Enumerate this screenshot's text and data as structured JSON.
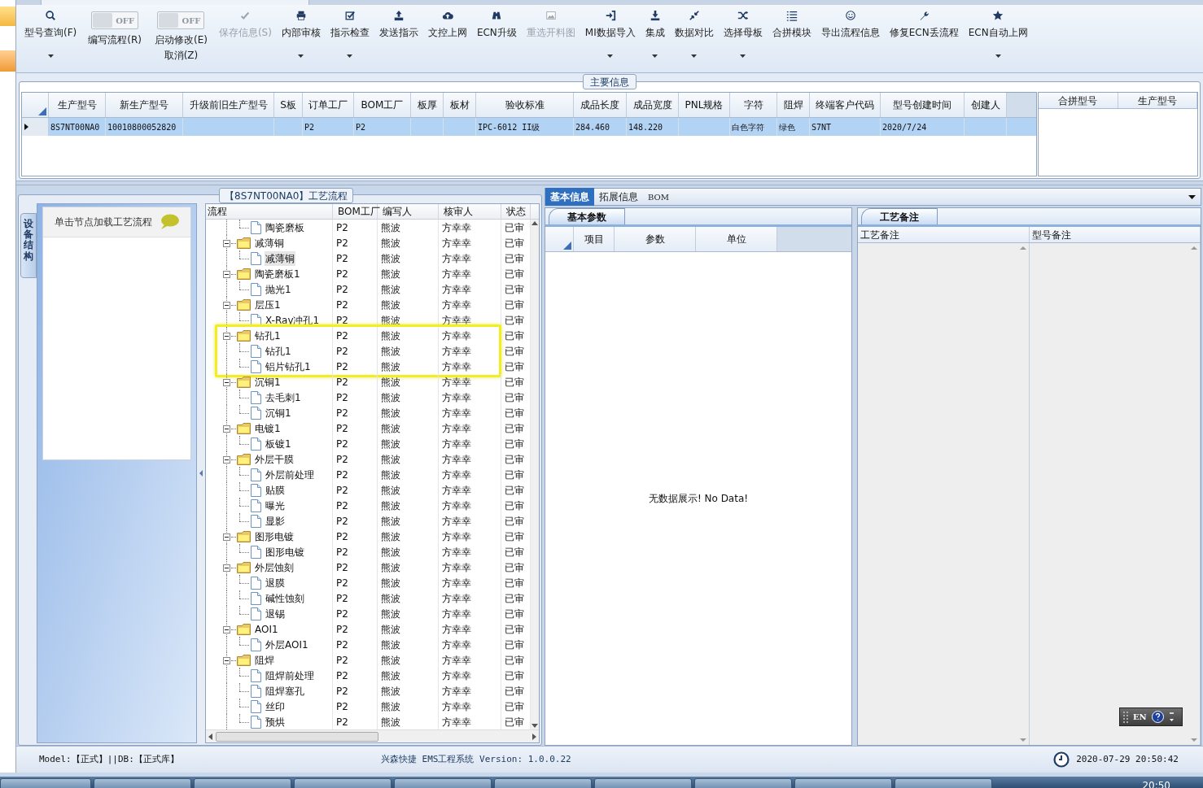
{
  "ribbon": {
    "items": [
      {
        "kind": "button",
        "label": "型号查询(F)",
        "dropdown": true,
        "disabled": false
      },
      {
        "kind": "toggle",
        "label": "编写流程(R)",
        "switch_text": "OFF",
        "on": false
      },
      {
        "kind": "toggle",
        "label": "启动修改(E)",
        "sublabel": "取消(Z)",
        "switch_text": "OFF",
        "on": false
      },
      {
        "kind": "button",
        "label": "保存信息(S)",
        "dropdown": false,
        "disabled": true
      },
      {
        "kind": "button",
        "label": "内部审核",
        "dropdown": true,
        "disabled": false
      },
      {
        "kind": "button",
        "label": "指示检查",
        "dropdown": true,
        "disabled": false
      },
      {
        "kind": "button",
        "label": "发送指示",
        "dropdown": false,
        "disabled": false
      },
      {
        "kind": "button",
        "label": "文控上网",
        "dropdown": false,
        "disabled": false
      },
      {
        "kind": "button",
        "label": "ECN升级",
        "dropdown": false,
        "disabled": false
      },
      {
        "kind": "button",
        "label": "重选开料图",
        "dropdown": false,
        "disabled": true
      },
      {
        "kind": "button",
        "label": "MI数据导入",
        "dropdown": true,
        "disabled": false
      },
      {
        "kind": "button",
        "label": "集成",
        "dropdown": true,
        "disabled": false
      },
      {
        "kind": "button",
        "label": "数据对比",
        "dropdown": true,
        "disabled": false
      },
      {
        "kind": "button",
        "label": "选择母板",
        "dropdown": true,
        "disabled": false
      },
      {
        "kind": "button",
        "label": "合拼模块",
        "dropdown": false,
        "disabled": false
      },
      {
        "kind": "button",
        "label": "导出流程信息",
        "dropdown": false,
        "disabled": false
      },
      {
        "kind": "button",
        "label": "修复ECN丢流程",
        "dropdown": false,
        "disabled": false
      },
      {
        "kind": "button",
        "label": "ECN自动上网",
        "dropdown": true,
        "disabled": false
      }
    ]
  },
  "main_info": {
    "title": "主要信息",
    "table": {
      "columns": [
        "生产型号",
        "新生产型号",
        "升级前旧生产型号",
        "S板",
        "订单工厂",
        "BOM工厂",
        "板厚",
        "板材",
        "验收标准",
        "成品长度",
        "成品宽度",
        "PNL规格",
        "字符",
        "阻焊",
        "终端客户代码",
        "型号创建时间",
        "创建人"
      ],
      "rows": [
        {
          "selected": true,
          "cells": [
            "8S7NT00NA0",
            "10010800052820",
            null,
            null,
            "P2",
            "P2",
            null,
            null,
            "IPC-6012 II级",
            "284.460",
            "148.220",
            null,
            "白色字符",
            "绿色",
            "S7NT",
            "2020/7/24",
            null
          ]
        }
      ]
    },
    "merge_table": {
      "columns": [
        "合拼型号",
        "生产型号"
      ]
    }
  },
  "process_panel": {
    "title": "【8S7NT00NA0】工艺流程",
    "side_tab": "设备结构",
    "hint": "单击节点加载工艺流程",
    "tree": {
      "columns": [
        "流程",
        "BOM工厂",
        "编写人",
        "核审人",
        "状态"
      ],
      "nodes": [
        {
          "children": [
            {
              "kind": "file",
              "label": "陶瓷磨板",
              "selected": false,
              "cells": [
                "P2",
                "熊波",
                "方幸幸",
                "已审"
              ]
            }
          ]
        },
        {
          "kind": "folder",
          "label": "减薄铜",
          "expanded": true,
          "selected": false,
          "highlighted": false,
          "cells": [
            "P2",
            "熊波",
            "方幸幸",
            "已审"
          ],
          "children": [
            {
              "kind": "file",
              "label": "减薄铜",
              "selected": true,
              "cells": [
                "P2",
                "熊波",
                "方幸幸",
                "已审"
              ]
            }
          ]
        },
        {
          "kind": "folder",
          "label": "陶瓷磨板1",
          "expanded": true,
          "selected": false,
          "highlighted": false,
          "cells": [
            "P2",
            "熊波",
            "方幸幸",
            "已审"
          ],
          "children": [
            {
              "kind": "file",
              "label": "抛光1",
              "selected": false,
              "cells": [
                "P2",
                "熊波",
                "方幸幸",
                "已审"
              ]
            }
          ]
        },
        {
          "kind": "folder",
          "label": "层压1",
          "expanded": true,
          "selected": false,
          "highlighted": false,
          "cells": [
            "P2",
            "熊波",
            "方幸幸",
            "已审"
          ],
          "children": [
            {
              "kind": "file",
              "label": "X-Ray冲孔1",
              "selected": false,
              "cells": [
                "P2",
                "熊波",
                "方幸幸",
                "已审"
              ]
            }
          ]
        },
        {
          "kind": "folder",
          "label": "钻孔1",
          "expanded": true,
          "selected": false,
          "highlighted": true,
          "cells": [
            "P2",
            "熊波",
            "方幸幸",
            "已审"
          ],
          "children": [
            {
              "kind": "file",
              "label": "钻孔1",
              "selected": false,
              "cells": [
                "P2",
                "熊波",
                "方幸幸",
                "已审"
              ]
            },
            {
              "kind": "file",
              "label": "铝片钻孔1",
              "selected": false,
              "cells": [
                "P2",
                "熊波",
                "方幸幸",
                "已审"
              ]
            }
          ]
        },
        {
          "kind": "folder",
          "label": "沉铜1",
          "expanded": true,
          "selected": false,
          "highlighted": false,
          "cells": [
            "P2",
            "熊波",
            "方幸幸",
            "已审"
          ],
          "children": [
            {
              "kind": "file",
              "label": "去毛刺1",
              "selected": false,
              "cells": [
                "P2",
                "熊波",
                "方幸幸",
                "已审"
              ]
            },
            {
              "kind": "file",
              "label": "沉铜1",
              "selected": false,
              "cells": [
                "P2",
                "熊波",
                "方幸幸",
                "已审"
              ]
            }
          ]
        },
        {
          "kind": "folder",
          "label": "电镀1",
          "expanded": true,
          "selected": false,
          "highlighted": false,
          "cells": [
            "P2",
            "熊波",
            "方幸幸",
            "已审"
          ],
          "children": [
            {
              "kind": "file",
              "label": "板镀1",
              "selected": false,
              "cells": [
                "P2",
                "熊波",
                "方幸幸",
                "已审"
              ]
            }
          ]
        },
        {
          "kind": "folder",
          "label": "外层干膜",
          "expanded": true,
          "selected": false,
          "highlighted": false,
          "cells": [
            "P2",
            "熊波",
            "方幸幸",
            "已审"
          ],
          "children": [
            {
              "kind": "file",
              "label": "外层前处理",
              "selected": false,
              "cells": [
                "P2",
                "熊波",
                "方幸幸",
                "已审"
              ]
            },
            {
              "kind": "file",
              "label": "贴膜",
              "selected": false,
              "cells": [
                "P2",
                "熊波",
                "方幸幸",
                "已审"
              ]
            },
            {
              "kind": "file",
              "label": "曝光",
              "selected": false,
              "cells": [
                "P2",
                "熊波",
                "方幸幸",
                "已审"
              ]
            },
            {
              "kind": "file",
              "label": "显影",
              "selected": false,
              "cells": [
                "P2",
                "熊波",
                "方幸幸",
                "已审"
              ]
            }
          ]
        },
        {
          "kind": "folder",
          "label": "图形电镀",
          "expanded": true,
          "selected": false,
          "highlighted": false,
          "cells": [
            "P2",
            "熊波",
            "方幸幸",
            "已审"
          ],
          "children": [
            {
              "kind": "file",
              "label": "图形电镀",
              "selected": false,
              "cells": [
                "P2",
                "熊波",
                "方幸幸",
                "已审"
              ]
            }
          ]
        },
        {
          "kind": "folder",
          "label": "外层蚀刻",
          "expanded": true,
          "selected": false,
          "highlighted": false,
          "cells": [
            "P2",
            "熊波",
            "方幸幸",
            "已审"
          ],
          "children": [
            {
              "kind": "file",
              "label": "退膜",
              "selected": false,
              "cells": [
                "P2",
                "熊波",
                "方幸幸",
                "已审"
              ]
            },
            {
              "kind": "file",
              "label": "碱性蚀刻",
              "selected": false,
              "cells": [
                "P2",
                "熊波",
                "方幸幸",
                "已审"
              ]
            },
            {
              "kind": "file",
              "label": "退锡",
              "selected": false,
              "cells": [
                "P2",
                "熊波",
                "方幸幸",
                "已审"
              ]
            }
          ]
        },
        {
          "kind": "folder",
          "label": "AOI1",
          "expanded": true,
          "selected": false,
          "highlighted": false,
          "cells": [
            "P2",
            "熊波",
            "方幸幸",
            "已审"
          ],
          "children": [
            {
              "kind": "file",
              "label": "外层AOI1",
              "selected": false,
              "cells": [
                "P2",
                "熊波",
                "方幸幸",
                "已审"
              ]
            }
          ]
        },
        {
          "kind": "folder",
          "label": "阻焊",
          "expanded": true,
          "selected": false,
          "highlighted": false,
          "cells": [
            "P2",
            "熊波",
            "方幸幸",
            "已审"
          ],
          "children": [
            {
              "kind": "file",
              "label": "阻焊前处理",
              "selected": false,
              "cells": [
                "P2",
                "熊波",
                "方幸幸",
                "已审"
              ]
            },
            {
              "kind": "file",
              "label": "阻焊塞孔",
              "selected": false,
              "cells": [
                "P2",
                "熊波",
                "方幸幸",
                "已审"
              ]
            },
            {
              "kind": "file",
              "label": "丝印",
              "selected": false,
              "cells": [
                "P2",
                "熊波",
                "方幸幸",
                "已审"
              ]
            },
            {
              "kind": "file",
              "label": "预烘",
              "selected": false,
              "cells": [
                "P2",
                "熊波",
                "方幸幸",
                "已审"
              ]
            }
          ]
        }
      ]
    }
  },
  "detail_panel": {
    "tabs": [
      {
        "label": "基本信息",
        "selected": true
      },
      {
        "label": "拓展信息",
        "selected": false
      },
      {
        "label": "BOM",
        "selected": false
      }
    ],
    "params": {
      "tab": "基本参数",
      "columns": [
        "项目",
        "参数",
        "单位"
      ],
      "empty_text": "无数据展示! No Data!"
    },
    "notes": {
      "tab": "工艺备注",
      "columns": [
        "工艺备注",
        "型号备注"
      ]
    }
  },
  "language_bar": {
    "text": "EN"
  },
  "status_bar": {
    "left": "Model:【正式】||DB:【正式库】",
    "center": "兴森快捷 EMS工程系统 Version: 1.0.0.22",
    "datetime": "2020-07-29 20:50:42"
  },
  "taskbar": {
    "clock": "20:50"
  }
}
